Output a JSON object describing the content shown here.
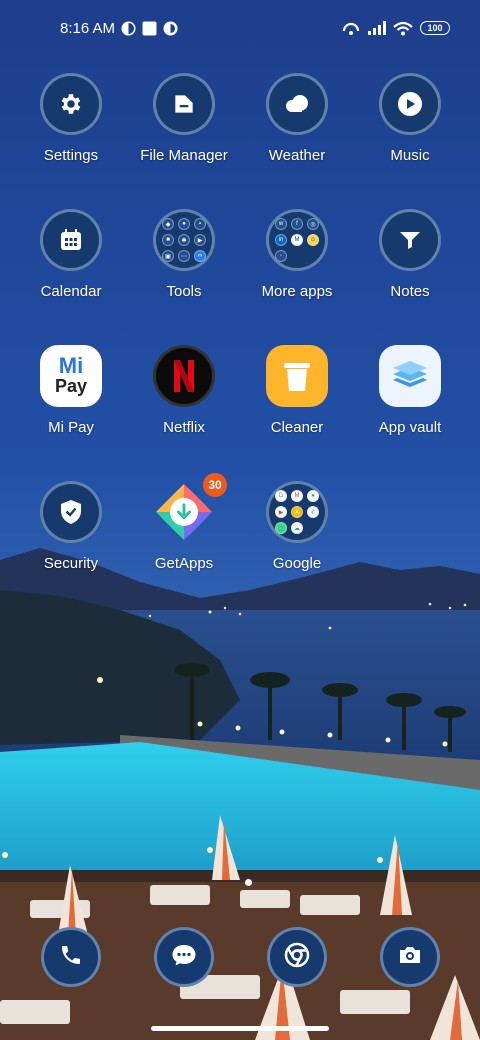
{
  "status_bar": {
    "time": "8:16 AM",
    "battery": "100",
    "icons": [
      "notification-icon",
      "square-icon",
      "notification-icon",
      "hotspot-icon",
      "signal-icon",
      "wifi-icon",
      "battery-icon"
    ]
  },
  "apps": [
    {
      "label": "Settings",
      "icon": "gear-icon"
    },
    {
      "label": "File Manager",
      "icon": "folder-icon"
    },
    {
      "label": "Weather",
      "icon": "cloud-icon"
    },
    {
      "label": "Music",
      "icon": "play-icon"
    },
    {
      "label": "Calendar",
      "icon": "calendar-icon"
    },
    {
      "label": "Tools",
      "icon": "folder-grid-icon"
    },
    {
      "label": "More apps",
      "icon": "folder-grid-icon"
    },
    {
      "label": "Notes",
      "icon": "notes-icon"
    },
    {
      "label": "Mi Pay",
      "icon": "mi-pay-icon"
    },
    {
      "label": "Netflix",
      "icon": "netflix-icon"
    },
    {
      "label": "Cleaner",
      "icon": "trash-icon"
    },
    {
      "label": "App vault",
      "icon": "layers-icon"
    },
    {
      "label": "Security",
      "icon": "shield-icon"
    },
    {
      "label": "GetApps",
      "icon": "getapps-icon",
      "badge": "30"
    },
    {
      "label": "Google",
      "icon": "folder-grid-icon"
    }
  ],
  "mipay_logo": {
    "top": "Mi",
    "bottom": "Pay"
  },
  "dock": [
    {
      "name": "phone",
      "icon": "phone-icon"
    },
    {
      "name": "messages",
      "icon": "message-icon"
    },
    {
      "name": "browser",
      "icon": "chrome-icon"
    },
    {
      "name": "camera",
      "icon": "camera-icon"
    }
  ],
  "colors": {
    "sky": "#1b3f8f",
    "icon_bg": "#163a6e",
    "badge": "#ef5a1b",
    "pool": "#22b7d8"
  }
}
